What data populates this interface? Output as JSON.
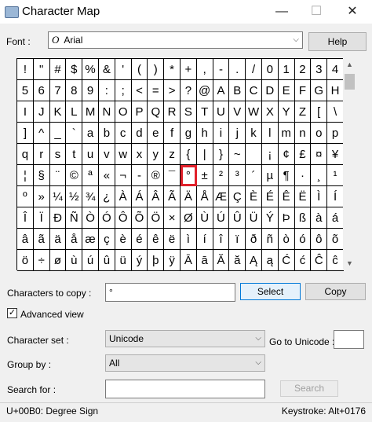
{
  "window": {
    "title": "Character Map",
    "minimize": "—",
    "maximize": "☐",
    "close": "✕"
  },
  "font": {
    "label": "Font :",
    "value": "Arial",
    "icon_glyph": "O",
    "help_label": "Help"
  },
  "grid": {
    "rows": [
      [
        "!",
        "\"",
        "#",
        "$",
        "%",
        "&",
        "'",
        "(",
        ")",
        "*",
        "+",
        ",",
        "-",
        ".",
        "/",
        "0",
        "1",
        "2",
        "3",
        "4"
      ],
      [
        "5",
        "6",
        "7",
        "8",
        "9",
        ":",
        ";",
        "<",
        "=",
        ">",
        "?",
        "@",
        "A",
        "B",
        "C",
        "D",
        "E",
        "F",
        "G",
        "H"
      ],
      [
        "I",
        "J",
        "K",
        "L",
        "M",
        "N",
        "O",
        "P",
        "Q",
        "R",
        "S",
        "T",
        "U",
        "V",
        "W",
        "X",
        "Y",
        "Z",
        "[",
        "\\"
      ],
      [
        "]",
        "^",
        "_",
        "`",
        "a",
        "b",
        "c",
        "d",
        "e",
        "f",
        "g",
        "h",
        "i",
        "j",
        "k",
        "l",
        "m",
        "n",
        "o",
        "p"
      ],
      [
        "q",
        "r",
        "s",
        "t",
        "u",
        "v",
        "w",
        "x",
        "y",
        "z",
        "{",
        "|",
        "}",
        "~",
        "",
        "¡",
        "¢",
        "£",
        "¤",
        "¥"
      ],
      [
        "¦",
        "§",
        "¨",
        "©",
        "ª",
        "«",
        "¬",
        "-",
        "®",
        "¯",
        "°",
        "±",
        "²",
        "³",
        "´",
        "µ",
        "¶",
        "·",
        "¸",
        "¹"
      ],
      [
        "º",
        "»",
        "¼",
        "½",
        "¾",
        "¿",
        "À",
        "Á",
        "Â",
        "Ã",
        "Ä",
        "Å",
        "Æ",
        "Ç",
        "È",
        "É",
        "Ê",
        "Ë",
        "Ì",
        "Í"
      ],
      [
        "Î",
        "Ï",
        "Ð",
        "Ñ",
        "Ò",
        "Ó",
        "Ô",
        "Õ",
        "Ö",
        "×",
        "Ø",
        "Ù",
        "Ú",
        "Û",
        "Ü",
        "Ý",
        "Þ",
        "ß",
        "à",
        "á"
      ],
      [
        "â",
        "ã",
        "ä",
        "å",
        "æ",
        "ç",
        "è",
        "é",
        "ê",
        "ë",
        "ì",
        "í",
        "î",
        "ï",
        "ð",
        "ñ",
        "ò",
        "ó",
        "ô",
        "õ"
      ],
      [
        "ö",
        "÷",
        "ø",
        "ù",
        "ú",
        "û",
        "ü",
        "ý",
        "þ",
        "ÿ",
        "Ā",
        "ā",
        "Ă",
        "ă",
        "Ą",
        "ą",
        "Ć",
        "ć",
        "Ĉ",
        "ĉ"
      ]
    ],
    "selected": {
      "row": 5,
      "col": 10
    },
    "selected_color": "#e0202a"
  },
  "copy": {
    "label": "Characters to copy :",
    "value": "°",
    "select_label": "Select",
    "copy_label": "Copy"
  },
  "advanced": {
    "label": "Advanced view",
    "checked": true,
    "check_glyph": "✓"
  },
  "charset": {
    "label": "Character set :",
    "value": "Unicode",
    "goto_label": "Go to Unicode :",
    "goto_value": ""
  },
  "groupby": {
    "label": "Group by :",
    "value": "All"
  },
  "search": {
    "label": "Search for :",
    "value": "",
    "button_label": "Search"
  },
  "status": {
    "left": "U+00B0: Degree Sign",
    "right": "Keystroke: Alt+0176"
  },
  "scroll": {
    "up": "▲",
    "down": "▼"
  }
}
